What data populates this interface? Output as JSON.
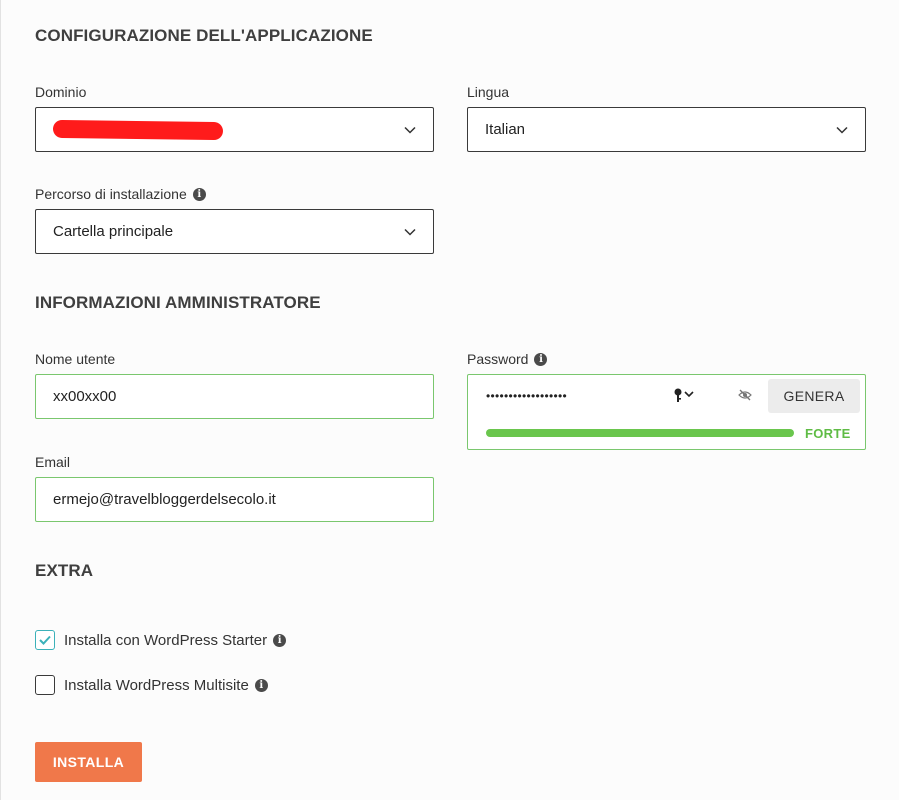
{
  "sections": {
    "app_config_title": "CONFIGURAZIONE DELL'APPLICAZIONE",
    "admin_info_title": "INFORMAZIONI AMMINISTRATORE",
    "extra_title": "EXTRA"
  },
  "domain": {
    "label": "Dominio",
    "value": ""
  },
  "language": {
    "label": "Lingua",
    "value": "Italian"
  },
  "install_path": {
    "label": "Percorso di installazione",
    "value": "Cartella principale"
  },
  "username": {
    "label": "Nome utente",
    "value": "xx00xx00"
  },
  "email": {
    "label": "Email",
    "value": "ermejo@travelbloggerdelsecolo.it"
  },
  "password": {
    "label": "Password",
    "masked_value": "••••••••••••••••••",
    "generate_label": "GENERA",
    "strength_label": "FORTE",
    "strength_fraction": 1.0
  },
  "extras": [
    {
      "label": "Installa con WordPress Starter",
      "checked": true
    },
    {
      "label": "Installa WordPress Multisite",
      "checked": false
    }
  ],
  "install_button": "INSTALLA",
  "icons": {
    "info": "info-icon",
    "chevron": "chevron-down-icon",
    "key": "key-icon",
    "eye": "eye-off-icon",
    "check": "check-icon"
  },
  "colors": {
    "accent": "#f0784a",
    "valid_border": "#7ac76e",
    "strength": "#6ac64d",
    "checkbox": "#3bb1b9",
    "redaction": "#ff1b1b"
  }
}
